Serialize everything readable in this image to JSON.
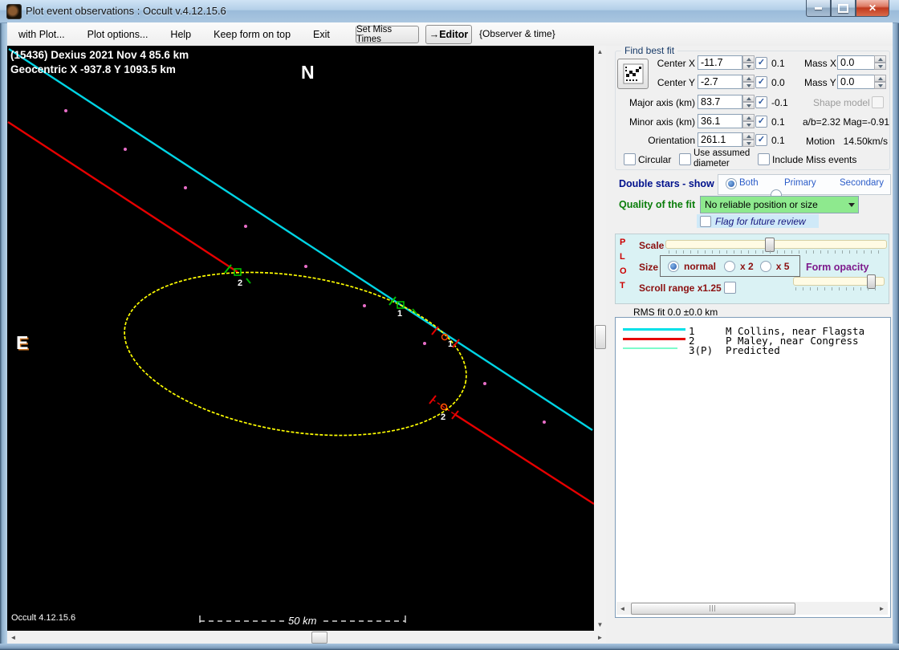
{
  "window": {
    "title": "Plot event observations : Occult v.4.12.15.6"
  },
  "icons": {
    "close": "✕",
    "checkmark": "✓",
    "arrow_up": "▲",
    "arrow_down": "▼",
    "arrow_left": "◄",
    "arrow_right": "►"
  },
  "menu": {
    "items": [
      "with Plot...",
      "Plot options...",
      "Help",
      "Keep form on top",
      "Exit"
    ],
    "set_miss_times_label": "Set Miss Times",
    "editor_label": "→Editor",
    "observer_time_label": "{Observer & time}"
  },
  "plot": {
    "title_line1": "(15436) Dexius  2021 Nov 4   85.6 km",
    "title_line2": "Geocentric  X  -937.8  Y 1093.5 km",
    "compass_north": "N",
    "compass_east": "E",
    "version_label": "Occult 4.12.15.6",
    "scale_label": "50 km",
    "markers": {
      "chord1_entry": "1",
      "chord1_exit": "1",
      "chord2_entry": "2",
      "chord2_exit": "2"
    },
    "colors": {
      "background": "#000000",
      "chord1": "#00d4e4",
      "chord2": "#e60000",
      "ellipse": "#ffff00",
      "predicted_dots": "#e86ec8"
    }
  },
  "fit_panel": {
    "group_label": "Find best fit",
    "rows": [
      {
        "label": "Center X",
        "value": "-11.7",
        "checked": true,
        "delta": "0.1"
      },
      {
        "label": "Center Y",
        "value": "-2.7",
        "checked": true,
        "delta": "0.0"
      },
      {
        "label": "Major axis (km)",
        "value": "83.7",
        "checked": true,
        "delta": "-0.1"
      },
      {
        "label": "Minor axis (km)",
        "value": "36.1",
        "checked": true,
        "delta": "0.1"
      },
      {
        "label": "Orientation",
        "value": "261.1",
        "checked": true,
        "delta": "0.1"
      }
    ],
    "mass_x_label": "Mass X",
    "mass_x_value": "0.0",
    "mass_y_label": "Mass Y",
    "mass_y_value": "0.0",
    "shape_model_label": "Shape model",
    "ab_mag_text": "a/b=2.32 Mag=-0.91",
    "motion_label": "Motion",
    "motion_value": "14.50km/s",
    "circular_label": "Circular",
    "use_assumed_label": "Use assumed diameter",
    "include_miss_label": "Include Miss events"
  },
  "double_stars": {
    "label": "Double stars - show",
    "options": [
      "Both",
      "Primary",
      "Secondary"
    ],
    "selected": "Both"
  },
  "quality": {
    "label": "Quality of the fit",
    "value": "No reliable position or size",
    "flag_label": "Flag for future review"
  },
  "plot_controls": {
    "plot_letters": [
      "P",
      "L",
      "O",
      "T"
    ],
    "scale_label": "Scale",
    "size_label": "Size",
    "size_options": [
      "normal",
      "x 2",
      "x 5"
    ],
    "size_selected": "normal",
    "form_opacity_label": "Form opacity",
    "scroll_range_label": "Scroll range x1.25"
  },
  "rms": {
    "label": "RMS fit 0.0 ±0.0 km"
  },
  "legend": {
    "items": [
      {
        "num": "1",
        "name": "M Collins, near Flagsta",
        "color": "#00e0e8"
      },
      {
        "num": "2",
        "name": "P Maley, near Congress",
        "color": "#e60000"
      },
      {
        "num": "3(P)",
        "name": "Predicted",
        "color": "#7dfccb"
      }
    ]
  }
}
